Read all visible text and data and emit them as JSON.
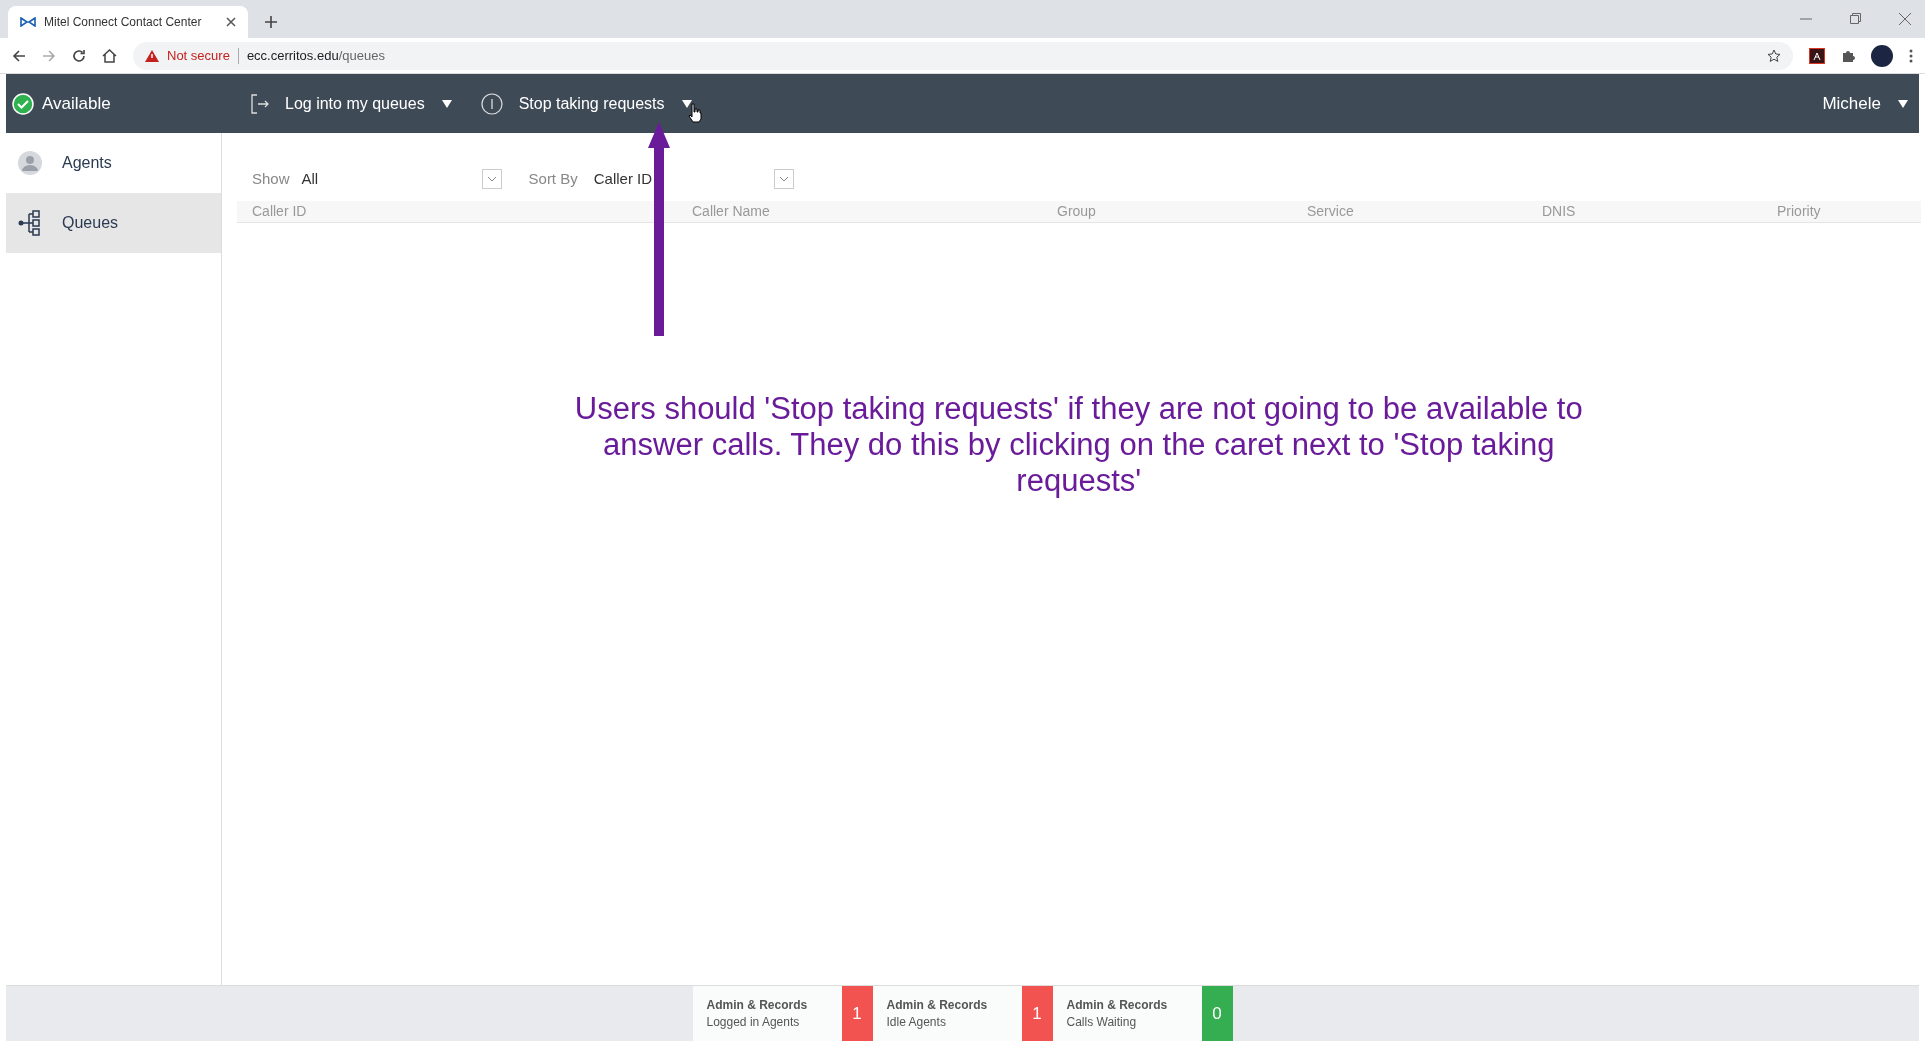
{
  "browser": {
    "tab_title": "Mitel Connect Contact Center",
    "security": "Not secure",
    "url_host": "ecc.cerritos.edu",
    "url_path": "/queues"
  },
  "header": {
    "status": "Available",
    "log_in": "Log into my queues",
    "stop": "Stop taking requests",
    "user": "Michele"
  },
  "sidebar": {
    "items": [
      {
        "label": "Agents",
        "kind": "agents",
        "selected": false
      },
      {
        "label": "Queues",
        "kind": "queues",
        "selected": true
      }
    ]
  },
  "filters": {
    "show_label": "Show",
    "show_value": "All",
    "sort_label": "Sort By",
    "sort_value": "Caller ID"
  },
  "table": {
    "columns": [
      "Caller ID",
      "Caller Name",
      "Group",
      "Service",
      "DNIS",
      "Priority"
    ]
  },
  "annotation": "Users should 'Stop taking requests' if they are not going to be available to answer calls. They do this by clicking on the caret next to 'Stop taking requests'",
  "status_bar": [
    {
      "title": "Admin & Records",
      "subtitle": "Logged in Agents",
      "count": "1",
      "color": "#f25350"
    },
    {
      "title": "Admin & Records",
      "subtitle": "Idle Agents",
      "count": "1",
      "color": "#f25350"
    },
    {
      "title": "Admin & Records",
      "subtitle": "Calls Waiting",
      "count": "0",
      "color": "#35ae52"
    }
  ]
}
